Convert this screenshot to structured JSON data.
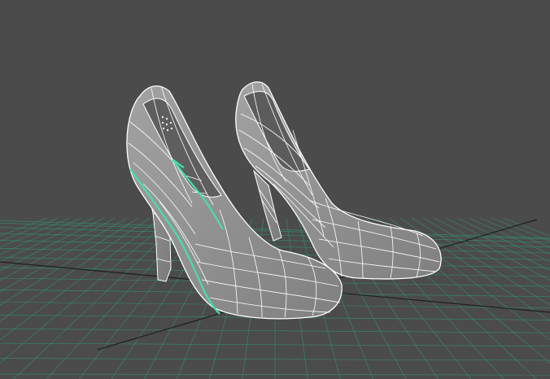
{
  "viewport": {
    "background_color": "#4b4b4b",
    "grid_color": "#2f9e78",
    "grid_dark_line_color": "#1e1e1e",
    "wire_color": "#ffffff",
    "selection_color": "#46e0a8"
  },
  "scene": {
    "objects": [
      {
        "name": "high-heel-shoe-left",
        "display": "wireframe-on-shaded",
        "selected_edges": true
      },
      {
        "name": "high-heel-shoe-right",
        "display": "wireframe-on-shaded",
        "selected_edges": false
      }
    ],
    "ground_grid": true
  }
}
